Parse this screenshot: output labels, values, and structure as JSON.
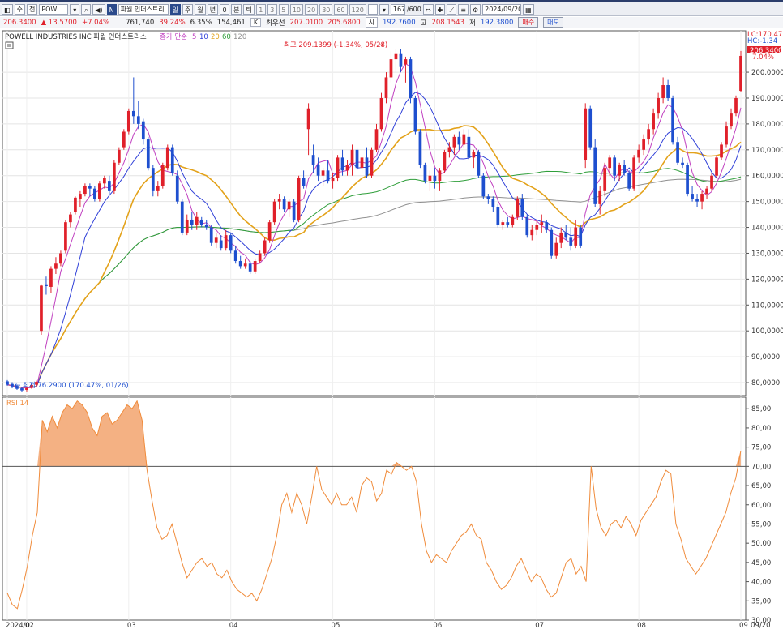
{
  "toolbar": {
    "market": "주",
    "mode": "전",
    "symbol": "POWL",
    "name": "파월 인더스트리",
    "period_active": "일",
    "periods": [
      "주",
      "월",
      "년",
      "0",
      "분",
      "틱"
    ],
    "minutes": [
      "1",
      "3",
      "5",
      "10",
      "20",
      "30",
      "60",
      "120"
    ],
    "count": "167",
    "count_total": "/600",
    "date": "2024/09/20"
  },
  "quote": {
    "price": "206.3400",
    "change": "▲ 13.5700",
    "change_pct": "+7.04%",
    "volume": "761,740",
    "pct1": "39.24%",
    "pct2": "6.35%",
    "amount": "154,461",
    "amount_unit": "K",
    "best_label": "최우선",
    "best_ask": "207.0100",
    "best_bid": "205.6800",
    "open_label": "시",
    "open": "192.7600",
    "high_label": "고",
    "high": "208.1543",
    "low_label": "저",
    "low": "192.3800",
    "buy_label": "매수",
    "sell_label": "매도"
  },
  "colors": {
    "up": "#e0202a",
    "down": "#1e4fcf",
    "ma5": "#c040c0",
    "ma10": "#3040d8",
    "ma20": "#e3a21a",
    "ma60": "#2f9e3a",
    "ma120": "#909090",
    "rsi": "#f08c3c",
    "rsi_fill": "#f4b183"
  },
  "chart_data": [
    {
      "type": "candlestick",
      "title": "POWELL INDUSTRIES INC",
      "subtitle": "파월 인더스트리스",
      "ma_label": "종가 단순",
      "series": [
        {
          "name": "5"
        },
        {
          "name": "10"
        },
        {
          "name": "20"
        },
        {
          "name": "60"
        },
        {
          "name": "120"
        }
      ],
      "ylim": [
        75,
        216
      ],
      "y_ticks": [
        "80,0000",
        "90,0000",
        "100,0000",
        "110,0000",
        "120,0000",
        "130,0000",
        "140,0000",
        "150,0000",
        "160,0000",
        "170,0000",
        "180,0000",
        "190,0000",
        "200,0000"
      ],
      "x_labels": [
        "2024/01",
        "02",
        "03",
        "04",
        "05",
        "06",
        "07",
        "08",
        "09",
        "09/20"
      ],
      "annotations": {
        "high": "최고 209.1399 (-1.34%, 05/28)",
        "low": "최저 76.2900 (170.47%, 01/26)",
        "lc": "LC:170.47",
        "hc": "HC:-1.34",
        "last": "206.3400",
        "last_pct": "7.04%"
      },
      "ohlc": [
        [
          80.5,
          81.0,
          78.8,
          79.2
        ],
        [
          79.5,
          80.2,
          77.8,
          78.5
        ],
        [
          78.7,
          79.2,
          77.2,
          77.6
        ],
        [
          77.8,
          78.4,
          76.3,
          77.0
        ],
        [
          77.2,
          78.3,
          76.6,
          77.9
        ],
        [
          78.0,
          79.8,
          77.6,
          79.1
        ],
        [
          79.2,
          80.8,
          78.6,
          80.3
        ],
        [
          100.0,
          118.0,
          98.5,
          117.5
        ],
        [
          118.0,
          121.0,
          114.0,
          117.3
        ],
        [
          117.0,
          125.0,
          114.5,
          124.0
        ],
        [
          124.0,
          128.5,
          122.0,
          126.0
        ],
        [
          126.0,
          131.0,
          125.0,
          130.0
        ],
        [
          131.0,
          143.0,
          130.0,
          142.0
        ],
        [
          142.0,
          146.0,
          140.0,
          145.0
        ],
        [
          146.0,
          152.0,
          145.0,
          151.5
        ],
        [
          151.0,
          154.0,
          148.0,
          153.0
        ],
        [
          153.0,
          157.0,
          152.0,
          156.0
        ],
        [
          156.0,
          157.0,
          152.0,
          155.0
        ],
        [
          155.0,
          156.0,
          150.0,
          151.0
        ],
        [
          151.0,
          158.0,
          150.0,
          157.0
        ],
        [
          157.0,
          160.0,
          155.0,
          159.0
        ],
        [
          158.0,
          160.0,
          153.0,
          154.0
        ],
        [
          154.0,
          166.0,
          153.0,
          165.0
        ],
        [
          165.0,
          171.0,
          164.0,
          170.0
        ],
        [
          171.0,
          178.0,
          170.0,
          177.0
        ],
        [
          177.0,
          186.0,
          176.0,
          185.0
        ],
        [
          185.0,
          198.0,
          180.0,
          183.0
        ],
        [
          183.0,
          189.0,
          178.0,
          180.0
        ],
        [
          181.0,
          182.0,
          172.0,
          174.0
        ],
        [
          174.0,
          175.0,
          162.0,
          163.0
        ],
        [
          163.0,
          164.0,
          152.0,
          154.0
        ],
        [
          154.0,
          158.0,
          152.0,
          156.0
        ],
        [
          156.0,
          165.0,
          155.0,
          164.0
        ],
        [
          163.0,
          172.0,
          162.0,
          171.0
        ],
        [
          171.0,
          172.0,
          160.0,
          161.0
        ],
        [
          160.0,
          162.0,
          149.0,
          150.0
        ],
        [
          150.0,
          151.0,
          137.0,
          138.0
        ],
        [
          138.0,
          145.0,
          137.0,
          143.0
        ],
        [
          143.0,
          146.0,
          139.0,
          141.0
        ],
        [
          141.0,
          146.0,
          139.0,
          144.0
        ],
        [
          143.0,
          144.0,
          140.0,
          141.0
        ],
        [
          141.0,
          143.0,
          139.0,
          140.0
        ],
        [
          140.0,
          141.0,
          133.0,
          134.0
        ],
        [
          134.0,
          138.0,
          132.0,
          136.0
        ],
        [
          135.0,
          137.0,
          131.0,
          132.0
        ],
        [
          132.0,
          139.0,
          131.0,
          137.0
        ],
        [
          137.0,
          138.0,
          130.0,
          131.0
        ],
        [
          131.0,
          133.0,
          126.0,
          127.0
        ],
        [
          127.0,
          129.0,
          124.0,
          125.0
        ],
        [
          125.0,
          128.0,
          124.0,
          126.0
        ],
        [
          126.0,
          127.0,
          122.0,
          123.0
        ],
        [
          123.0,
          128.0,
          122.0,
          127.0
        ],
        [
          127.0,
          131.0,
          126.0,
          130.0
        ],
        [
          130.0,
          136.0,
          129.0,
          135.0
        ],
        [
          135.0,
          143.0,
          134.0,
          142.0
        ],
        [
          142.0,
          151.0,
          141.0,
          150.0
        ],
        [
          150.0,
          153.0,
          147.0,
          151.0
        ],
        [
          151.0,
          152.0,
          146.0,
          147.0
        ],
        [
          147.0,
          151.0,
          144.0,
          150.0
        ],
        [
          150.0,
          151.0,
          142.0,
          143.0
        ],
        [
          143.0,
          160.0,
          142.0,
          159.0
        ],
        [
          159.0,
          162.0,
          155.0,
          156.0
        ],
        [
          178.0,
          188.0,
          168.0,
          186.0
        ],
        [
          168.0,
          172.0,
          161.0,
          164.0
        ],
        [
          164.0,
          167.0,
          158.0,
          160.0
        ],
        [
          160.0,
          163.0,
          156.0,
          162.0
        ],
        [
          162.0,
          166.0,
          157.0,
          158.0
        ],
        [
          158.0,
          161.0,
          155.0,
          159.0
        ],
        [
          159.0,
          168.0,
          158.0,
          167.0
        ],
        [
          167.0,
          170.0,
          160.0,
          162.0
        ],
        [
          162.0,
          166.0,
          160.0,
          164.0
        ],
        [
          164.0,
          172.0,
          160.0,
          170.0
        ],
        [
          170.0,
          171.0,
          162.0,
          163.0
        ],
        [
          163.0,
          168.0,
          161.0,
          167.0
        ],
        [
          167.0,
          171.0,
          159.0,
          160.0
        ],
        [
          160.0,
          171.0,
          159.0,
          170.0
        ],
        [
          170.0,
          180.0,
          169.0,
          178.0
        ],
        [
          178.0,
          192.0,
          177.0,
          190.0
        ],
        [
          190.0,
          200.0,
          188.0,
          198.0
        ],
        [
          198.0,
          208.0,
          196.0,
          205.0
        ],
        [
          205.0,
          209.0,
          200.0,
          207.0
        ],
        [
          207.0,
          209.1,
          200.0,
          202.0
        ],
        [
          203.0,
          206.0,
          196.0,
          205.0
        ],
        [
          205.0,
          206.0,
          188.0,
          190.0
        ],
        [
          190.0,
          191.0,
          176.0,
          177.0
        ],
        [
          177.0,
          178.0,
          163.0,
          164.0
        ],
        [
          164.0,
          165.0,
          157.0,
          158.0
        ],
        [
          158.0,
          162.0,
          154.0,
          160.0
        ],
        [
          160.0,
          163.0,
          155.0,
          158.0
        ],
        [
          158.0,
          163.0,
          154.0,
          162.0
        ],
        [
          162.0,
          170.0,
          161.0,
          169.0
        ],
        [
          169.0,
          173.0,
          167.0,
          171.0
        ],
        [
          171.0,
          176.0,
          168.0,
          175.0
        ],
        [
          175.0,
          177.0,
          170.0,
          172.0
        ],
        [
          172.0,
          178.0,
          171.0,
          176.0
        ],
        [
          175.0,
          178.0,
          166.0,
          167.0
        ],
        [
          167.0,
          170.0,
          163.0,
          169.0
        ],
        [
          169.0,
          170.0,
          159.0,
          160.0
        ],
        [
          160.0,
          161.0,
          151.0,
          152.0
        ],
        [
          152.0,
          153.0,
          149.0,
          151.0
        ],
        [
          151.0,
          152.0,
          146.0,
          148.0
        ],
        [
          148.0,
          149.0,
          140.0,
          141.0
        ],
        [
          141.0,
          143.0,
          139.0,
          142.0
        ],
        [
          142.0,
          144.0,
          140.0,
          141.0
        ],
        [
          141.0,
          145.0,
          140.0,
          144.0
        ],
        [
          144.0,
          152.0,
          143.0,
          151.0
        ],
        [
          151.0,
          153.0,
          143.0,
          144.0
        ],
        [
          144.0,
          145.0,
          136.0,
          137.0
        ],
        [
          137.0,
          141.0,
          135.0,
          139.0
        ],
        [
          139.0,
          143.0,
          137.0,
          141.0
        ],
        [
          141.0,
          145.0,
          138.0,
          142.0
        ],
        [
          142.0,
          143.0,
          138.0,
          139.0
        ],
        [
          139.0,
          140.0,
          128.0,
          129.0
        ],
        [
          129.0,
          136.0,
          128.0,
          134.0
        ],
        [
          134.0,
          140.0,
          132.0,
          138.0
        ],
        [
          138.0,
          141.0,
          135.0,
          136.0
        ],
        [
          136.0,
          140.0,
          131.0,
          133.0
        ],
        [
          133.0,
          143.0,
          132.0,
          140.0
        ],
        [
          140.0,
          141.0,
          132.0,
          133.0
        ],
        [
          166.0,
          188.0,
          163.0,
          186.0
        ],
        [
          186.0,
          187.0,
          170.0,
          171.0
        ],
        [
          171.0,
          174.0,
          148.0,
          149.0
        ],
        [
          149.0,
          156.0,
          145.0,
          154.0
        ],
        [
          154.0,
          165.0,
          152.0,
          163.0
        ],
        [
          163.0,
          168.0,
          160.0,
          167.0
        ],
        [
          167.0,
          168.0,
          158.0,
          160.0
        ],
        [
          160.0,
          165.0,
          158.0,
          164.0
        ],
        [
          164.0,
          166.0,
          160.0,
          161.0
        ],
        [
          161.0,
          162.0,
          154.0,
          155.0
        ],
        [
          155.0,
          168.0,
          154.0,
          167.0
        ],
        [
          167.0,
          172.0,
          165.0,
          170.0
        ],
        [
          170.0,
          176.0,
          168.0,
          174.0
        ],
        [
          174.0,
          180.0,
          172.0,
          178.0
        ],
        [
          178.0,
          186.0,
          176.0,
          184.0
        ],
        [
          184.0,
          192.0,
          182.0,
          190.0
        ],
        [
          190.0,
          198.0,
          188.0,
          195.0
        ],
        [
          195.0,
          197.0,
          189.0,
          190.0
        ],
        [
          190.0,
          191.0,
          172.0,
          173.0
        ],
        [
          173.0,
          175.0,
          164.0,
          165.0
        ],
        [
          165.0,
          167.0,
          163.0,
          164.0
        ],
        [
          164.0,
          165.0,
          152.0,
          153.0
        ],
        [
          153.0,
          156.0,
          150.0,
          151.0
        ],
        [
          151.0,
          153.0,
          148.0,
          150.0
        ],
        [
          150.0,
          154.0,
          147.0,
          153.0
        ],
        [
          153.0,
          156.0,
          151.0,
          155.0
        ],
        [
          155.0,
          161.0,
          154.0,
          160.0
        ],
        [
          160.0,
          168.0,
          159.0,
          167.0
        ],
        [
          167.0,
          173.0,
          166.0,
          172.0
        ],
        [
          172.0,
          181.0,
          171.0,
          179.0
        ],
        [
          179.0,
          186.0,
          178.0,
          184.0
        ],
        [
          184.0,
          191.0,
          183.0,
          190.0
        ],
        [
          192.8,
          208.2,
          192.4,
          206.3
        ]
      ]
    },
    {
      "type": "line",
      "title": "RSI 14",
      "ylim": [
        30,
        88
      ],
      "y_ticks": [
        "30,00",
        "35,00",
        "40,00",
        "45,00",
        "50,00",
        "55,00",
        "60,00",
        "65,00",
        "70,00",
        "75,00",
        "80,00",
        "85,00"
      ],
      "threshold": 70,
      "values": [
        37,
        34,
        33,
        38,
        44,
        52,
        58,
        82,
        79,
        83,
        80,
        84,
        86,
        85,
        87,
        86,
        84,
        80,
        78,
        83,
        84,
        81,
        82,
        84,
        86,
        85,
        87,
        82,
        69,
        61,
        54,
        51,
        52,
        55,
        50,
        45,
        41,
        43,
        45,
        46,
        44,
        45,
        42,
        41,
        43,
        40,
        38,
        37,
        36,
        37,
        35,
        38,
        42,
        46,
        52,
        60,
        63,
        58,
        63,
        60,
        55,
        62,
        70,
        64,
        62,
        60,
        63,
        60,
        60,
        62,
        58,
        65,
        67,
        66,
        61,
        63,
        69,
        68,
        71,
        70,
        69,
        70,
        66,
        55,
        48,
        45,
        47,
        46,
        45,
        48,
        50,
        52,
        53,
        55,
        52,
        51,
        45,
        43,
        40,
        38,
        39,
        41,
        44,
        46,
        43,
        40,
        42,
        41,
        38,
        36,
        37,
        41,
        45,
        46,
        42,
        44,
        40,
        70,
        59,
        54,
        52,
        55,
        56,
        54,
        57,
        55,
        52,
        56,
        58,
        60,
        62,
        66,
        69,
        68,
        55,
        51,
        46,
        44,
        42,
        44,
        46,
        49,
        52,
        55,
        58,
        63,
        67,
        74
      ]
    }
  ]
}
